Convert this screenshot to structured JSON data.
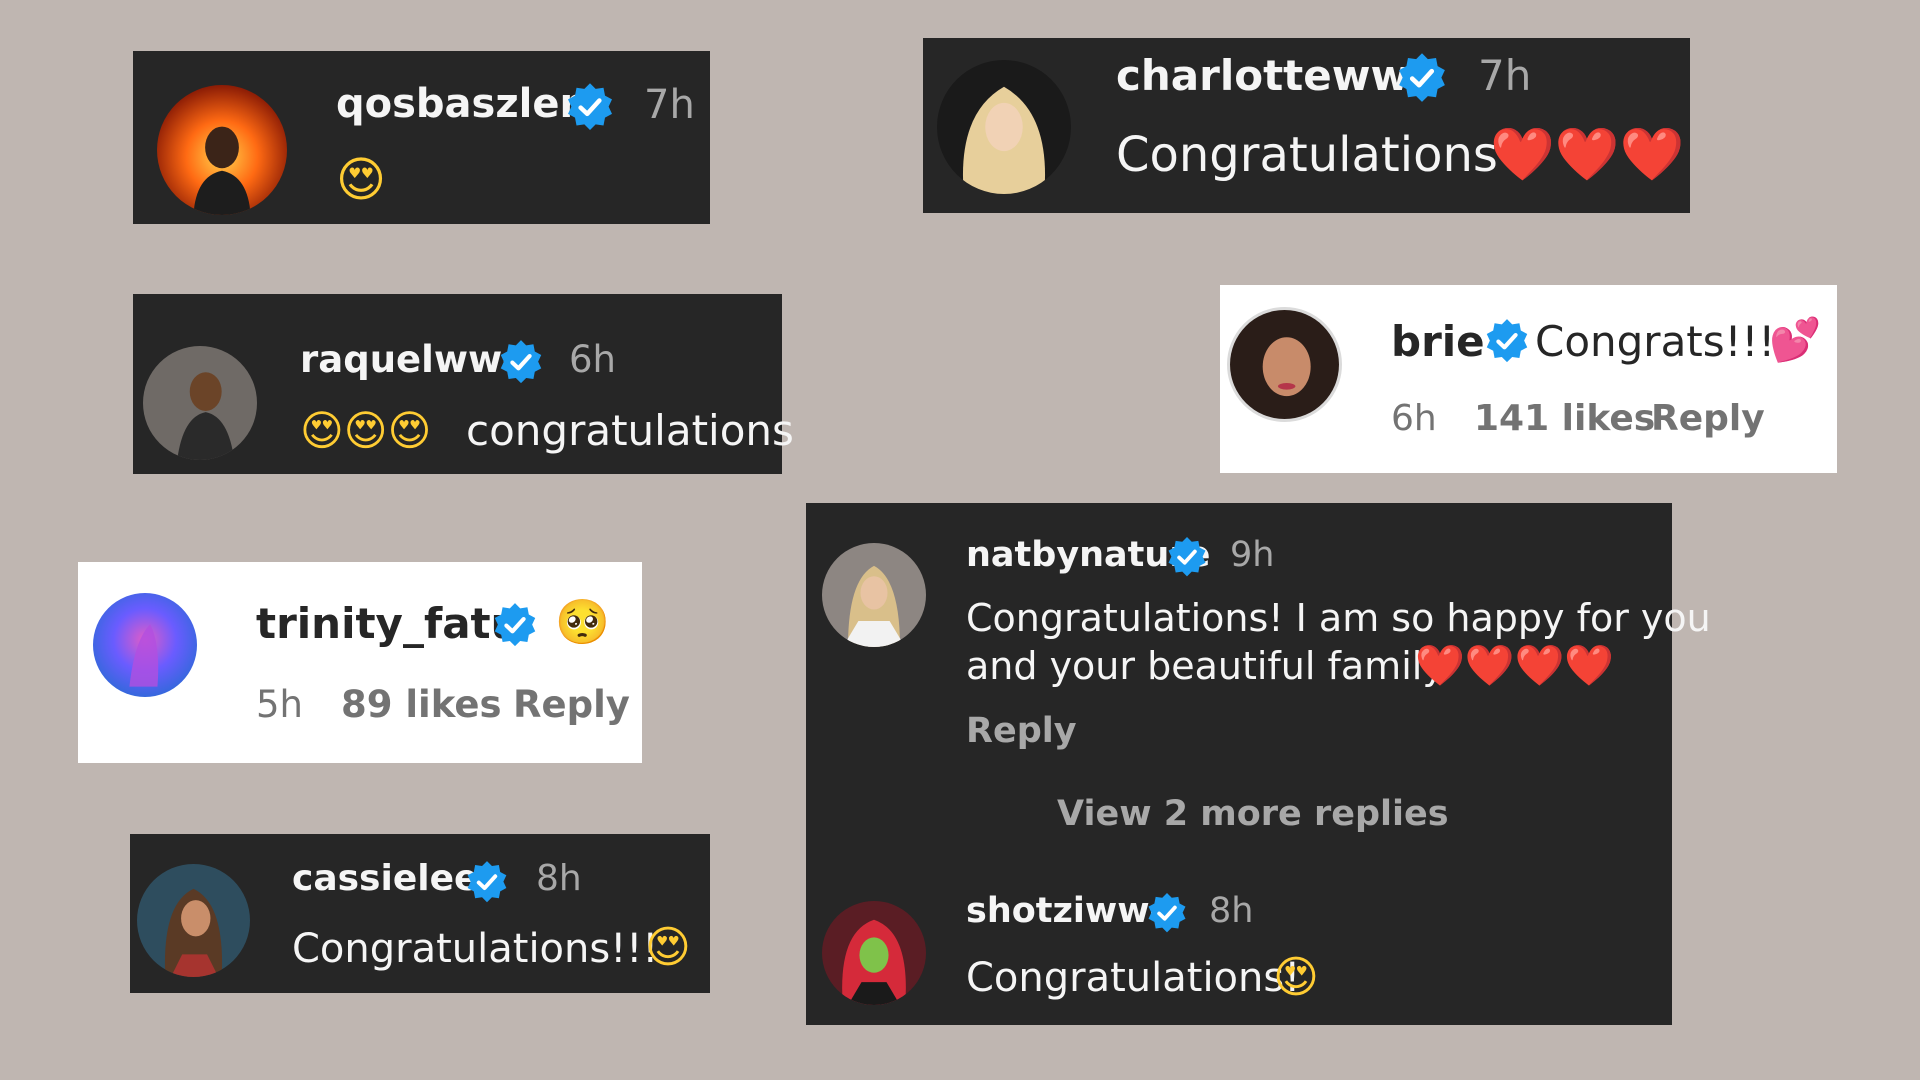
{
  "comments": {
    "qosbaszler": {
      "username": "qosbaszler",
      "time": "7h",
      "text": "😍"
    },
    "charlottewwe": {
      "username": "charlottewwe",
      "time": "7h",
      "text": "Congratulations",
      "emojis": "❤️❤️❤️"
    },
    "raquelwwe": {
      "username": "raquelwwe",
      "time": "6h",
      "emojis": "😍😍😍",
      "text": "congratulations"
    },
    "brie": {
      "username": "brie",
      "text": "Congrats!!!",
      "emoji": "💕",
      "time": "6h",
      "likes": "141 likes",
      "reply": "Reply"
    },
    "trinity_fatu": {
      "username": "trinity_fatu",
      "emoji": "🥺",
      "time": "5h",
      "likes": "89 likes",
      "reply": "Reply"
    },
    "natbynature": {
      "username": "natbynature",
      "time": "9h",
      "line1": "Congratulations! I am so happy for you",
      "line2": "and your beautiful family",
      "emojis": "❤️❤️❤️❤️",
      "reply": "Reply",
      "more_replies": "View 2 more replies"
    },
    "shotziwwe": {
      "username": "shotziwwe",
      "time": "8h",
      "text": "Congratulations!",
      "emoji": "😍"
    },
    "cassielee": {
      "username": "cassielee",
      "time": "8h",
      "text": "Congratulations!!!",
      "emoji": "😍"
    }
  },
  "colors": {
    "dark_card": "#262626",
    "light_card": "#ffffff",
    "background": "#bfb6b1",
    "verified": "#1d9bf0",
    "heart": "#ff2d3d"
  }
}
